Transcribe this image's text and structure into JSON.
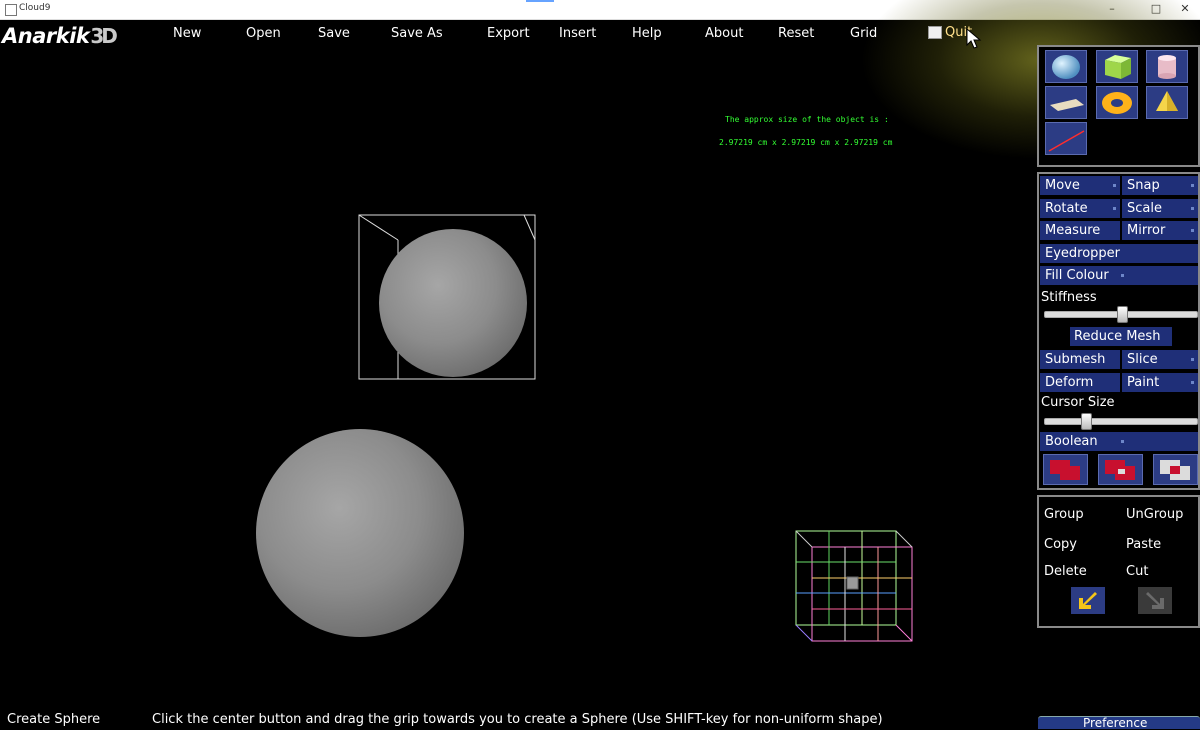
{
  "window": {
    "title": "Cloud9"
  },
  "logo": {
    "part1": "Anarkik",
    "part2": "3D"
  },
  "menu": {
    "new": "New",
    "open": "Open",
    "save": "Save",
    "save_as": "Save As",
    "export": "Export",
    "insert": "Insert",
    "help": "Help",
    "about": "About",
    "reset": "Reset",
    "grid": "Grid",
    "quit": "Quit"
  },
  "viewport": {
    "size_line1": "The approx size of the object is :",
    "size_line2": "2.97219  cm  x  2.97219  cm  x  2.97219  cm"
  },
  "shapes": [
    "sphere-icon",
    "cube-icon",
    "cylinder-icon",
    "plane-icon",
    "torus-icon",
    "cone-icon",
    "line-icon"
  ],
  "tools": {
    "move": "Move",
    "snap": "Snap",
    "rotate": "Rotate",
    "scale": "Scale",
    "measure": "Measure",
    "mirror": "Mirror",
    "eyedropper": "Eyedropper",
    "fill_colour": "Fill Colour",
    "stiffness": "Stiffness",
    "stiffness_value": 0.5,
    "reduce_mesh": "Reduce Mesh",
    "submesh": "Submesh",
    "slice": "Slice",
    "deform": "Deform",
    "paint": "Paint",
    "cursor_size": "Cursor Size",
    "cursor_size_value": 0.25,
    "boolean": "Boolean"
  },
  "edit": {
    "group": "Group",
    "ungroup": "UnGroup",
    "copy": "Copy",
    "paste": "Paste",
    "delete": "Delete",
    "cut": "Cut"
  },
  "status": {
    "mode": "Create Sphere",
    "hint": "Click the center button and drag the grip towards you to create a Sphere (Use SHIFT-key for non-uniform shape)"
  },
  "preference": "Preference",
  "colors": {
    "menu_text": "#ffffff",
    "info_text": "#33ff33",
    "button_bg": "#1f2f78",
    "quit_text": "#ffe08a"
  }
}
